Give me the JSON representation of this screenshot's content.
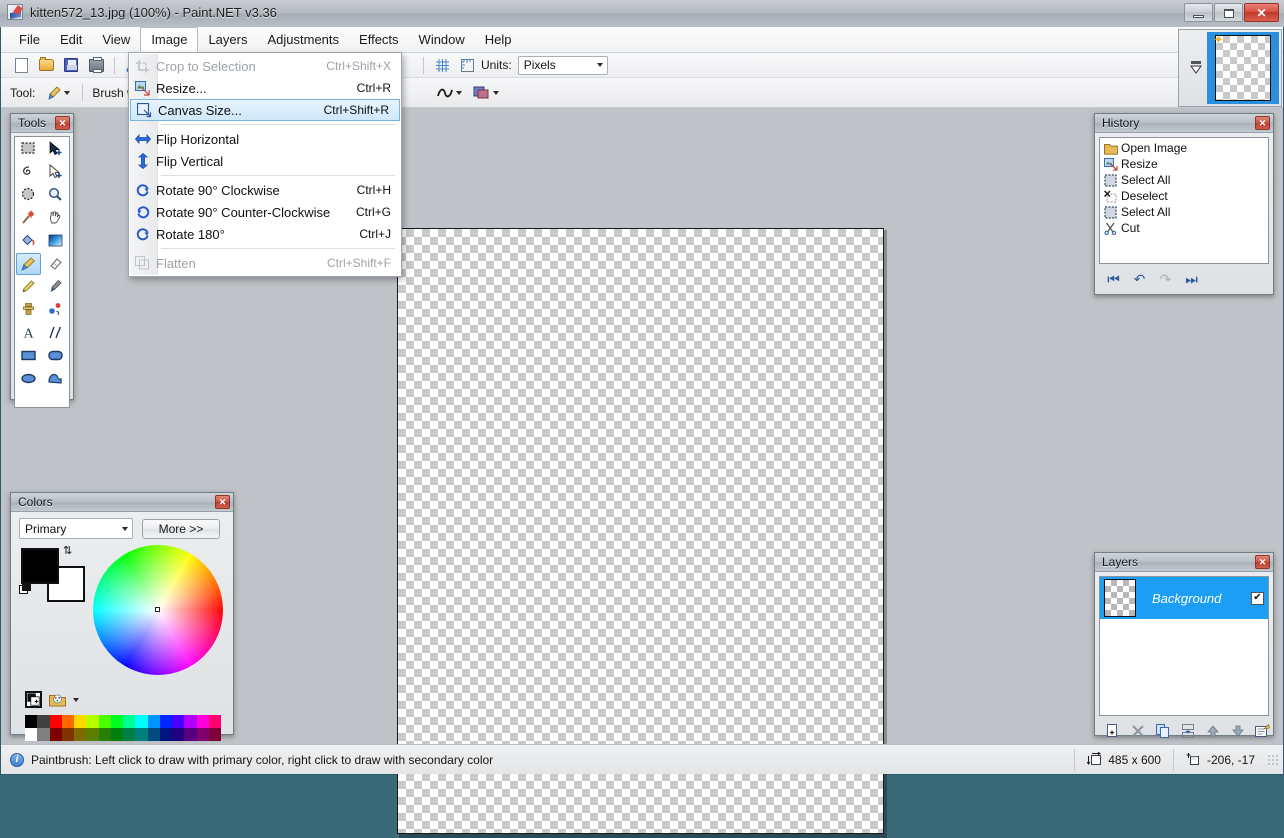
{
  "window": {
    "title": "kitten572_13.jpg (100%) - Paint.NET v3.36",
    "app_icon": "paintnet-icon",
    "minimize": "–",
    "maximize": "□",
    "close": "✕"
  },
  "menubar": {
    "items": [
      {
        "label": "File",
        "open": false
      },
      {
        "label": "Edit",
        "open": false
      },
      {
        "label": "View",
        "open": false
      },
      {
        "label": "Image",
        "open": true
      },
      {
        "label": "Layers",
        "open": false
      },
      {
        "label": "Adjustments",
        "open": false
      },
      {
        "label": "Effects",
        "open": false
      },
      {
        "label": "Window",
        "open": false
      },
      {
        "label": "Help",
        "open": false
      }
    ]
  },
  "image_menu": {
    "items": [
      {
        "label": "Crop to Selection",
        "shortcut": "Ctrl+Shift+X",
        "disabled": true,
        "highlighted": false,
        "icon": "crop-icon",
        "sep_after": false
      },
      {
        "label": "Resize...",
        "shortcut": "Ctrl+R",
        "disabled": false,
        "highlighted": false,
        "icon": "resize-icon",
        "sep_after": false
      },
      {
        "label": "Canvas Size...",
        "shortcut": "Ctrl+Shift+R",
        "disabled": false,
        "highlighted": true,
        "icon": "canvas-size-icon",
        "sep_after": true
      },
      {
        "label": "Flip Horizontal",
        "shortcut": "",
        "disabled": false,
        "highlighted": false,
        "icon": "flip-horizontal-icon",
        "sep_after": false
      },
      {
        "label": "Flip Vertical",
        "shortcut": "",
        "disabled": false,
        "highlighted": false,
        "icon": "flip-vertical-icon",
        "sep_after": true
      },
      {
        "label": "Rotate 90° Clockwise",
        "shortcut": "Ctrl+H",
        "disabled": false,
        "highlighted": false,
        "icon": "rotate-cw-icon",
        "sep_after": false
      },
      {
        "label": "Rotate 90° Counter-Clockwise",
        "shortcut": "Ctrl+G",
        "disabled": false,
        "highlighted": false,
        "icon": "rotate-ccw-icon",
        "sep_after": false
      },
      {
        "label": "Rotate 180°",
        "shortcut": "Ctrl+J",
        "disabled": false,
        "highlighted": false,
        "icon": "rotate-180-icon",
        "sep_after": true
      },
      {
        "label": "Flatten",
        "shortcut": "Ctrl+Shift+F",
        "disabled": true,
        "highlighted": false,
        "icon": "flatten-icon",
        "sep_after": false
      }
    ]
  },
  "toolbar": {
    "buttons": [
      {
        "name": "new-file-button",
        "icon": "new-page-icon"
      },
      {
        "name": "open-file-button",
        "icon": "open-folder-icon"
      },
      {
        "name": "save-file-button",
        "icon": "save-floppy-icon"
      },
      {
        "name": "print-button",
        "icon": "printer-icon"
      },
      {
        "name": "cut-button",
        "icon": "scissors-icon"
      }
    ],
    "grid_icon": "grid-icon",
    "ruler_icon": "ruler-icon",
    "units_label": "Units:",
    "units_value": "Pixels"
  },
  "toolbar2": {
    "tool_label": "Tool:",
    "tool_icon": "paintbrush-icon",
    "brush_label": "Brush w",
    "shape_icon": "curve-icon",
    "blend_icon": "blend-mode-icon"
  },
  "tools_panel": {
    "title": "Tools",
    "close": "✕",
    "selected": "paintbrush",
    "tools": [
      {
        "name": "rectangle-select-tool",
        "icon": "rectangle-select-icon"
      },
      {
        "name": "move-selected-tool",
        "icon": "move-selected-icon"
      },
      {
        "name": "lasso-select-tool",
        "icon": "lasso-select-icon"
      },
      {
        "name": "move-selection-tool",
        "icon": "move-selection-icon"
      },
      {
        "name": "ellipse-select-tool",
        "icon": "ellipse-select-icon"
      },
      {
        "name": "zoom-tool",
        "icon": "magnifier-icon"
      },
      {
        "name": "magic-wand-tool",
        "icon": "magic-wand-icon"
      },
      {
        "name": "pan-tool",
        "icon": "hand-icon"
      },
      {
        "name": "paint-bucket-tool",
        "icon": "paint-bucket-icon"
      },
      {
        "name": "gradient-tool",
        "icon": "gradient-icon"
      },
      {
        "name": "paintbrush-tool",
        "icon": "paintbrush-icon"
      },
      {
        "name": "eraser-tool",
        "icon": "eraser-icon"
      },
      {
        "name": "pencil-tool",
        "icon": "pencil-icon"
      },
      {
        "name": "color-picker-tool",
        "icon": "eyedropper-icon"
      },
      {
        "name": "clone-stamp-tool",
        "icon": "clone-stamp-icon"
      },
      {
        "name": "recolor-tool",
        "icon": "recolor-icon"
      },
      {
        "name": "text-tool",
        "icon": "text-a-icon"
      },
      {
        "name": "line-curve-tool",
        "icon": "line-curve-icon"
      },
      {
        "name": "rectangle-tool",
        "icon": "rectangle-icon"
      },
      {
        "name": "rounded-rectangle-tool",
        "icon": "rounded-rectangle-icon"
      },
      {
        "name": "ellipse-tool",
        "icon": "ellipse-icon"
      },
      {
        "name": "freeform-shape-tool",
        "icon": "freeform-shape-icon"
      }
    ]
  },
  "colors_panel": {
    "title": "Colors",
    "close": "✕",
    "mode_value": "Primary",
    "more_label": "More >>",
    "primary_color": "#000000",
    "secondary_color": "#ffffff",
    "palette_row1": [
      "#000000",
      "#404040",
      "#ff0000",
      "#ff6a00",
      "#ffd800",
      "#b6ff00",
      "#4cff00",
      "#00ff21",
      "#00ff90",
      "#00ffff",
      "#0094ff",
      "#0026ff",
      "#4800ff",
      "#b200ff",
      "#ff00dc",
      "#ff006e"
    ],
    "palette_row2": [
      "#ffffff",
      "#808080",
      "#7f0000",
      "#7f3300",
      "#7f6a00",
      "#5b7f00",
      "#267f00",
      "#007f0e",
      "#007f46",
      "#007f7f",
      "#004a7f",
      "#00137f",
      "#21007f",
      "#57007f",
      "#7f006e",
      "#7f0037"
    ]
  },
  "history_panel": {
    "title": "History",
    "close": "✕",
    "items": [
      {
        "label": "Open Image",
        "icon": "open-folder-icon"
      },
      {
        "label": "Resize",
        "icon": "resize-icon"
      },
      {
        "label": "Select All",
        "icon": "select-all-icon"
      },
      {
        "label": "Deselect",
        "icon": "deselect-icon"
      },
      {
        "label": "Select All",
        "icon": "select-all-icon"
      },
      {
        "label": "Cut",
        "icon": "scissors-icon"
      }
    ],
    "nav": [
      {
        "name": "history-rewind-button",
        "glyph": "⏮",
        "disabled": false
      },
      {
        "name": "history-undo-button",
        "glyph": "↶",
        "disabled": false
      },
      {
        "name": "history-redo-button",
        "glyph": "↷",
        "disabled": true
      },
      {
        "name": "history-forward-button",
        "glyph": "⏭",
        "disabled": false
      }
    ]
  },
  "layers_panel": {
    "title": "Layers",
    "close": "✕",
    "layers": [
      {
        "name": "Background",
        "visible": true,
        "selected": true,
        "check": "✔"
      }
    ],
    "buttons": [
      {
        "name": "add-layer-button",
        "glyph": "add"
      },
      {
        "name": "delete-layer-button",
        "glyph": "delete"
      },
      {
        "name": "duplicate-layer-button",
        "glyph": "duplicate"
      },
      {
        "name": "merge-layer-down-button",
        "glyph": "merge"
      },
      {
        "name": "move-layer-up-button",
        "glyph": "up"
      },
      {
        "name": "move-layer-down-button",
        "glyph": "down"
      },
      {
        "name": "layer-properties-button",
        "glyph": "properties"
      }
    ]
  },
  "thumbnail_strip": {
    "selected_thumb": "kitten572_13.jpg",
    "star": "✦"
  },
  "statusbar": {
    "info_icon": "info-icon",
    "message": "Paintbrush: Left click to draw with primary color, right click to draw with secondary color",
    "size_icon": "image-size-icon",
    "size_value": "485 x 600",
    "cursor_icon": "cursor-position-icon",
    "cursor_value": "-206, -17"
  },
  "colors": {
    "accent_blue": "#1c9ef5",
    "menu_highlight": "#cfe8fa",
    "titlebar_close": "#c0382b"
  }
}
